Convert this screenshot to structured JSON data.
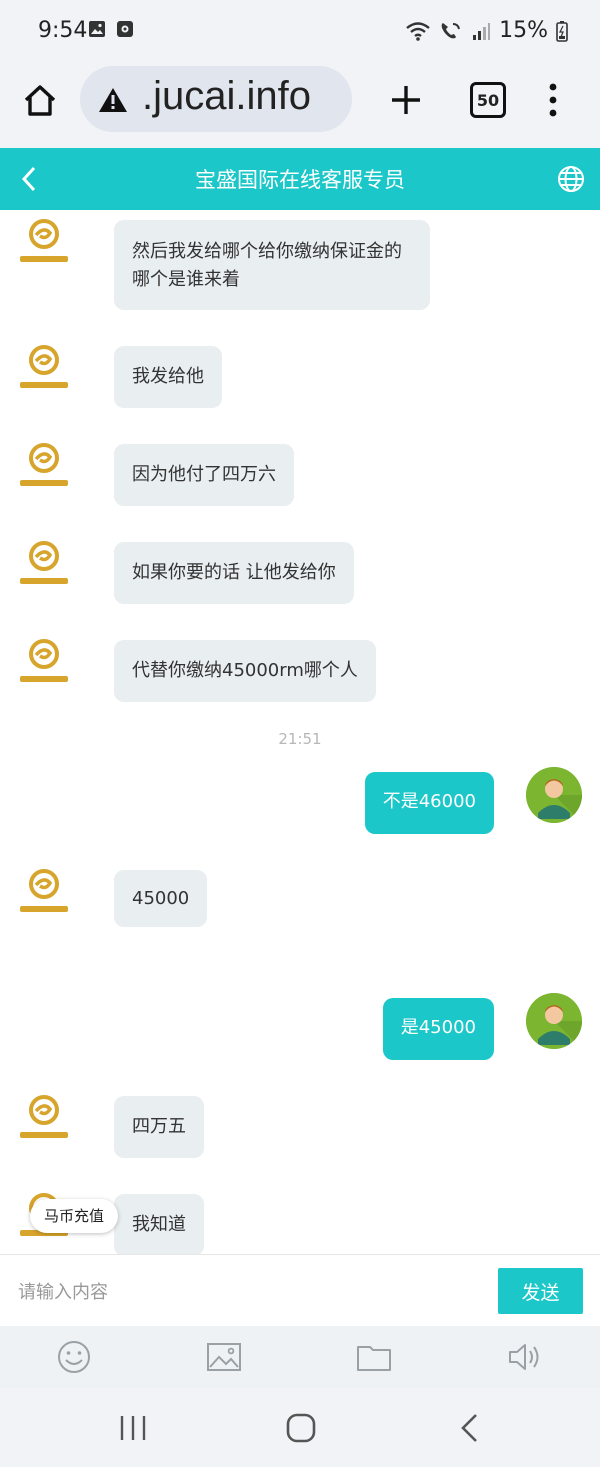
{
  "status": {
    "time": "9:54",
    "battery": "15%",
    "icons": [
      "gallery-icon",
      "app-notification-icon",
      "wifi-icon",
      "wifi-calling-icon",
      "signal-icon",
      "battery-icon"
    ]
  },
  "browser": {
    "url": ".jucai.info",
    "tab_count": "50",
    "icons": [
      "home-icon",
      "warning-icon",
      "plus-icon",
      "tabs-icon",
      "more-vert-icon"
    ]
  },
  "header": {
    "title": "宝盛国际在线客服专员",
    "icons": [
      "back-icon",
      "globe-icon"
    ]
  },
  "messages": [
    {
      "side": "in",
      "text": "然后我发给哪个给你缴纳保证金的\n哪个是谁来着"
    },
    {
      "side": "in",
      "text": "我发给他"
    },
    {
      "side": "in",
      "text": "因为他付了四万六"
    },
    {
      "side": "in",
      "text": "如果你要的话 让他发给你"
    },
    {
      "side": "in",
      "text": "代替你缴纳45000rm哪个人"
    },
    {
      "side": "out",
      "text": "不是46000"
    },
    {
      "side": "in",
      "text": "45000"
    },
    {
      "side": "out",
      "text": "是45000"
    },
    {
      "side": "in",
      "text": "四万五"
    },
    {
      "side": "in",
      "text": "我知道"
    }
  ],
  "timestamp": "21:51",
  "floating_tag": "马币充值",
  "input": {
    "placeholder": "请输入内容",
    "value": "",
    "send_label": "发送"
  },
  "toolbar": [
    "emoji-icon",
    "image-icon",
    "folder-icon",
    "volume-icon"
  ],
  "nav": [
    "recent-apps-icon",
    "home-nav-icon",
    "back-nav-icon"
  ],
  "colors": {
    "accent": "#1bc7c8",
    "incoming_bubble": "#e9eef0",
    "logo_gold": "#d7a42c",
    "avatar_green": "#7cb630"
  }
}
